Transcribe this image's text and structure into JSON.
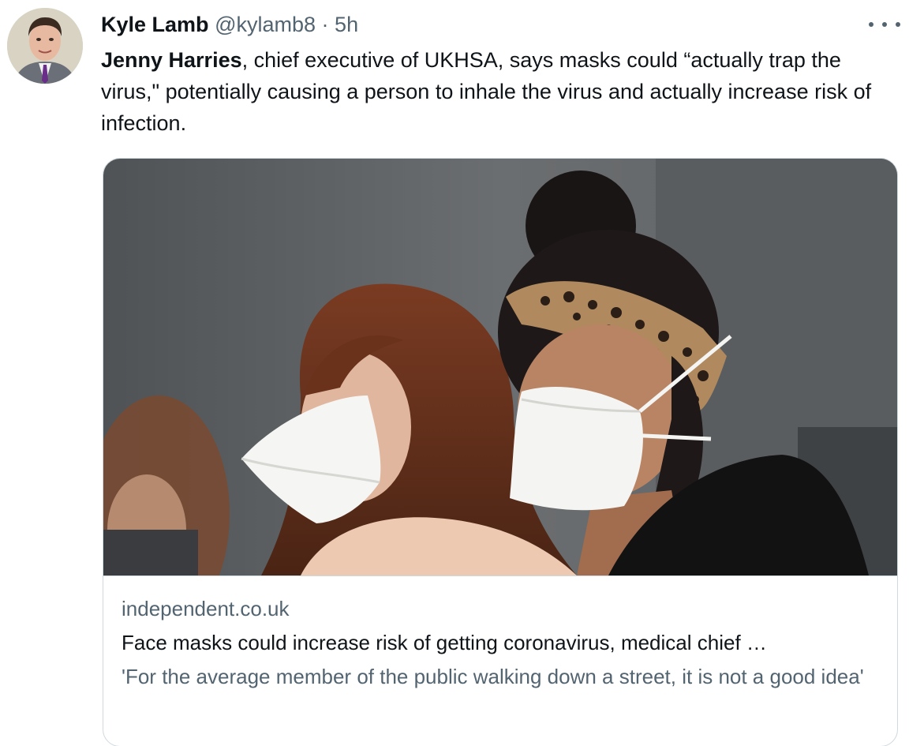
{
  "author": {
    "name": "Kyle Lamb",
    "handle": "@kylamb8",
    "separator": "·",
    "time": "5h"
  },
  "tweet": {
    "mention": "Jenny Harries",
    "text": ", chief executive of UKHSA, says masks could “actually trap the virus,\" potentially causing a person to inhale the virus and actually increase risk of infection."
  },
  "card": {
    "domain": "independent.co.uk",
    "title": "Face masks could increase risk of getting coronavirus, medical chief …",
    "description": "'For the average member of the public walking down a street, it is not a good idea'"
  },
  "icons": {
    "more": "more-options-icon"
  }
}
